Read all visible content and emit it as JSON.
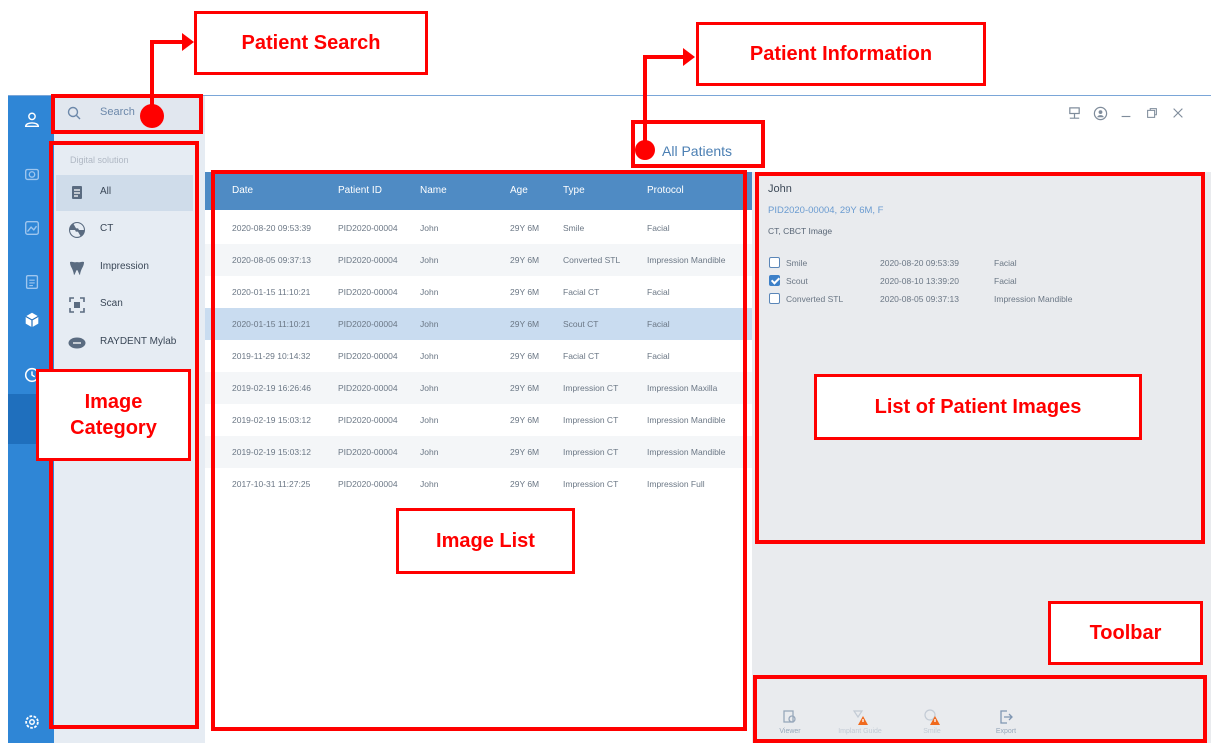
{
  "search": {
    "placeholder": "Search"
  },
  "window": {
    "title": "All Patients"
  },
  "categories": {
    "heading": "Digital solution",
    "items": [
      {
        "label": "All",
        "icon": "document-stack-icon",
        "selected": true
      },
      {
        "label": "CT",
        "icon": "radiation-icon",
        "selected": false
      },
      {
        "label": "Impression",
        "icon": "tooth-icon",
        "selected": false
      },
      {
        "label": "Scan",
        "icon": "scan-icon",
        "selected": false
      },
      {
        "label": "RAYDENT Mylab",
        "icon": "raydent-logo-icon",
        "selected": false
      }
    ]
  },
  "table": {
    "columns": [
      "Date",
      "Patient ID",
      "Name",
      "Age",
      "Type",
      "Protocol"
    ],
    "rows": [
      {
        "date": "2020-08-20 09:53:39",
        "pid": "PID2020-00004",
        "name": "John",
        "age": "29Y 6M",
        "type": "Smile",
        "protocol": "Facial"
      },
      {
        "date": "2020-08-05 09:37:13",
        "pid": "PID2020-00004",
        "name": "John",
        "age": "29Y 6M",
        "type": "Converted STL",
        "protocol": "Impression Mandible"
      },
      {
        "date": "2020-01-15 11:10:21",
        "pid": "PID2020-00004",
        "name": "John",
        "age": "29Y 6M",
        "type": "Facial CT",
        "protocol": "Facial"
      },
      {
        "date": "2020-01-15 11:10:21",
        "pid": "PID2020-00004",
        "name": "John",
        "age": "29Y 6M",
        "type": "Scout CT",
        "protocol": "Facial"
      },
      {
        "date": "2019-11-29 10:14:32",
        "pid": "PID2020-00004",
        "name": "John",
        "age": "29Y 6M",
        "type": "Facial CT",
        "protocol": "Facial"
      },
      {
        "date": "2019-02-19 16:26:46",
        "pid": "PID2020-00004",
        "name": "John",
        "age": "29Y 6M",
        "type": "Impression CT",
        "protocol": "Impression Maxilla"
      },
      {
        "date": "2019-02-19 15:03:12",
        "pid": "PID2020-00004",
        "name": "John",
        "age": "29Y 6M",
        "type": "Impression CT",
        "protocol": "Impression Mandible"
      },
      {
        "date": "2019-02-19 15:03:12",
        "pid": "PID2020-00004",
        "name": "John",
        "age": "29Y 6M",
        "type": "Impression CT",
        "protocol": "Impression Mandible"
      },
      {
        "date": "2017-10-31 11:27:25",
        "pid": "PID2020-00004",
        "name": "John",
        "age": "29Y 6M",
        "type": "Impression CT",
        "protocol": "Impression Full"
      }
    ]
  },
  "patient": {
    "name": "John",
    "summary": "PID2020-00004, 29Y 6M, F",
    "modalities": "CT, CBCT Image",
    "images": [
      {
        "label": "Smile",
        "date": "2020-08-20 09:53:39",
        "protocol": "Facial",
        "checked": false
      },
      {
        "label": "Scout",
        "date": "2020-08-10 13:39:20",
        "protocol": "Facial",
        "checked": true
      },
      {
        "label": "Converted STL",
        "date": "2020-08-05 09:37:13",
        "protocol": "Impression Mandible",
        "checked": false
      }
    ]
  },
  "toolbar": {
    "viewer": "Viewer",
    "implant_guide": "Implant Guide",
    "smile": "Smile",
    "export": "Export"
  },
  "annotations": {
    "patient_search": "Patient Search",
    "patient_information": "Patient Information",
    "image_category": "Image Category",
    "image_list": "Image List",
    "list_of_patient_images": "List of Patient Images",
    "toolbar": "Toolbar"
  },
  "colors": {
    "rail": "#2f86d6",
    "header": "#4f8bc4",
    "annotation": "#ff0000"
  }
}
